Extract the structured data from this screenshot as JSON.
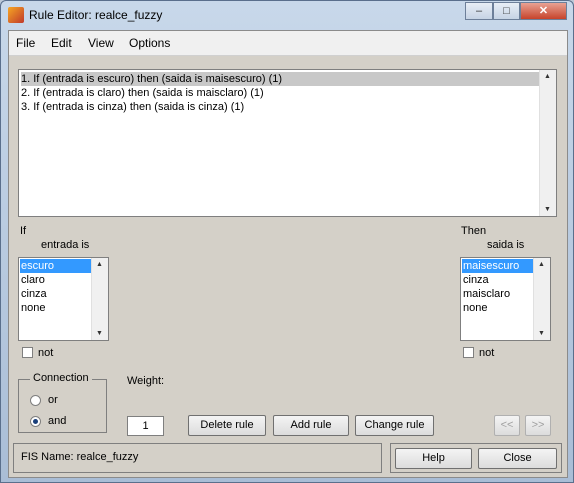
{
  "window": {
    "title": "Rule Editor: realce_fuzzy"
  },
  "titlebar_buttons": {
    "minimize": "–",
    "maximize": "□",
    "close": "✕"
  },
  "menu": [
    "File",
    "Edit",
    "View",
    "Options"
  ],
  "rules": [
    "1. If (entrada is escuro) then (saida is maisescuro) (1)",
    "2. If (entrada is claro) then (saida is maisclaro) (1)",
    "3. If (entrada is cinza) then (saida is cinza) (1)"
  ],
  "selected_rule": 0,
  "if_section": {
    "label": "If",
    "variable_label": "entrada is",
    "options": [
      "escuro",
      "claro",
      "cinza",
      "none"
    ],
    "selected": 0,
    "not_label": "not"
  },
  "then_section": {
    "label": "Then",
    "variable_label": "saida is",
    "options": [
      "maisescuro",
      "cinza",
      "maisclaro",
      "none"
    ],
    "selected": 0,
    "not_label": "not"
  },
  "connection": {
    "label": "Connection",
    "options": [
      "or",
      "and"
    ],
    "selected": "and"
  },
  "weight": {
    "label": "Weight:",
    "value": "1"
  },
  "buttons": {
    "delete": "Delete rule",
    "add": "Add rule",
    "change": "Change rule",
    "prev": "<<",
    "next": ">>",
    "help": "Help",
    "close": "Close"
  },
  "status": "FIS Name: realce_fuzzy",
  "icons": {
    "app": "matlab-icon",
    "scroll_up": "scroll-up-arrow-icon",
    "scroll_down": "scroll-down-arrow-icon"
  }
}
